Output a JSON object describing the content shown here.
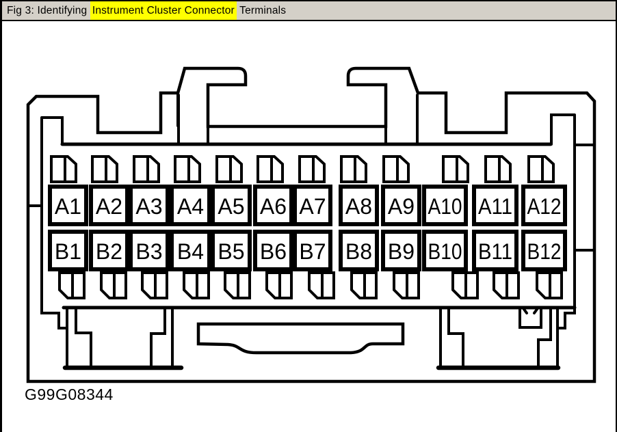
{
  "header": {
    "title_prefix": "Fig 3: Identifying ",
    "title_highlight": "Instrument Cluster Connector",
    "title_suffix": " Terminals"
  },
  "figure": {
    "code": "G99G08344"
  },
  "connector": {
    "name": "instrument-cluster-connector",
    "row_a_labels": [
      "A1",
      "A2",
      "A3",
      "A4",
      "A5",
      "A6",
      "A7",
      "A8",
      "A9",
      "A10",
      "A11",
      "A12"
    ],
    "row_b_labels": [
      "B1",
      "B2",
      "B3",
      "B4",
      "B5",
      "B6",
      "B7",
      "B8",
      "B9",
      "B10",
      "B11",
      "B12"
    ]
  },
  "colors": {
    "line": "#000000",
    "text": "#000000",
    "page_background": "#ffffff",
    "header_background": "#d4d0c8",
    "highlight": "#ffff00"
  }
}
